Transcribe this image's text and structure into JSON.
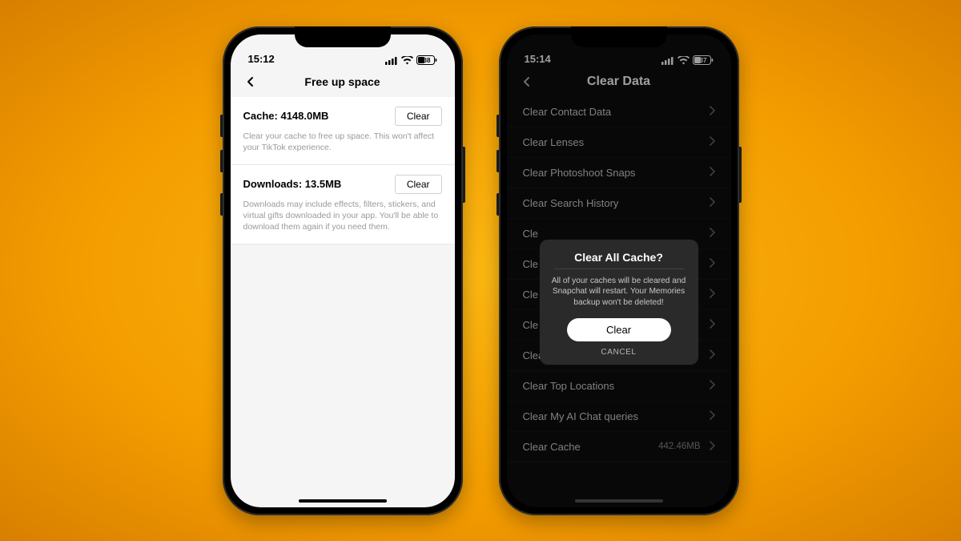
{
  "tiktok": {
    "status_time": "15:12",
    "status_battery": "38",
    "header_title": "Free up space",
    "cache": {
      "label": "Cache: 4148.0MB",
      "button": "Clear",
      "desc": "Clear your cache to free up space. This won't affect your TikTok experience."
    },
    "downloads": {
      "label": "Downloads: 13.5MB",
      "button": "Clear",
      "desc": "Downloads may include effects, filters, stickers, and virtual gifts downloaded in your app. You'll be able to download them again if you need them."
    }
  },
  "snapchat": {
    "status_time": "15:14",
    "status_battery": "37",
    "header_title": "Clear Data",
    "items": [
      {
        "label": "Clear Contact Data",
        "size": ""
      },
      {
        "label": "Clear Lenses",
        "size": ""
      },
      {
        "label": "Clear Photoshoot Snaps",
        "size": ""
      },
      {
        "label": "Clear Search History",
        "size": ""
      },
      {
        "label": "Cle",
        "size": ""
      },
      {
        "label": "Cle",
        "size": ""
      },
      {
        "label": "Cle",
        "size": ""
      },
      {
        "label": "Cle",
        "size": ""
      },
      {
        "label": "Clear Shopping History",
        "size": ""
      },
      {
        "label": "Clear Top Locations",
        "size": ""
      },
      {
        "label": "Clear My AI Chat queries",
        "size": ""
      },
      {
        "label": "Clear Cache",
        "size": "442.46MB"
      }
    ],
    "modal": {
      "title": "Clear All Cache?",
      "body": "All of your caches will be cleared and Snapchat will restart. Your Memories backup won't be deleted!",
      "clear": "Clear",
      "cancel": "CANCEL"
    }
  }
}
